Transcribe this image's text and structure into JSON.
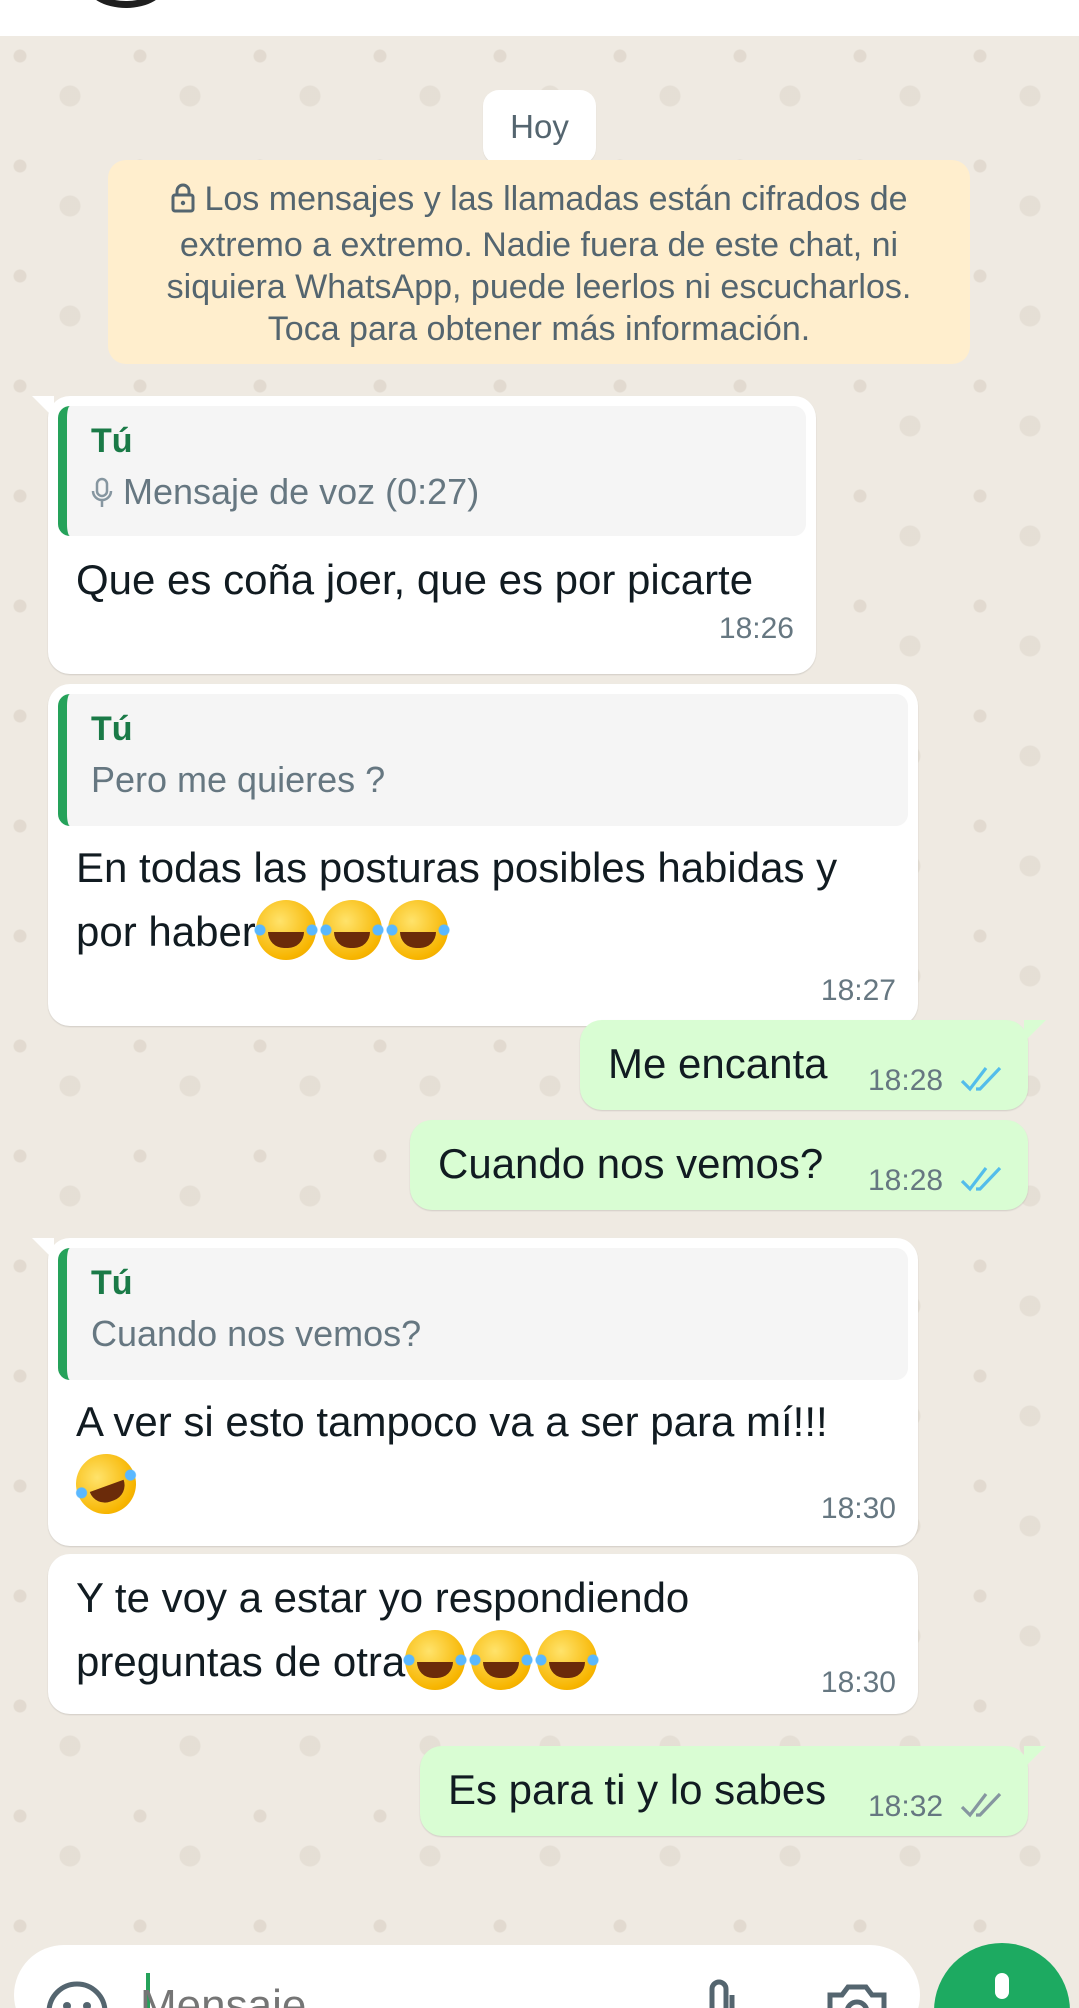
{
  "chat": {
    "day_chip": "Hoy",
    "encryption_notice": "Los mensajes y las llamadas están cifrados de extremo a extremo. Nadie fuera de este chat, ni siquiera WhatsApp, puede leerlos ni escucharlos. Toca para obtener más información.",
    "messages": [
      {
        "direction": "in",
        "quote_author": "Tú",
        "quote_text": "Mensaje de voz (0:27)",
        "quote_icon": "mic-icon",
        "text": "Que es coña joer, que es por picarte",
        "time": "18:26"
      },
      {
        "direction": "in",
        "quote_author": "Tú",
        "quote_text": "Pero me quieres ?",
        "text_line1": "En todas las posturas posibles habidas y",
        "text_line2": "por haber",
        "emoji": "😂😂😂",
        "time": "18:27"
      },
      {
        "direction": "out",
        "text": "Me encanta",
        "time": "18:28",
        "status": "read"
      },
      {
        "direction": "out",
        "text": "Cuando nos vemos?",
        "time": "18:28",
        "status": "read"
      },
      {
        "direction": "in",
        "quote_author": "Tú",
        "quote_text": "Cuando nos vemos?",
        "text": "A ver si esto tampoco va a ser para mí!!!",
        "emoji": "🤣",
        "time": "18:30"
      },
      {
        "direction": "in",
        "text_line1": "Y te voy a estar yo respondiendo",
        "text_line2": "preguntas de otra",
        "emoji": "😂😂😂",
        "time": "18:30"
      },
      {
        "direction": "out",
        "text": "Es para ti y lo sabes",
        "time": "18:32",
        "status": "delivered"
      }
    ]
  },
  "composer": {
    "placeholder": "Mensaje",
    "icons": [
      "emoji-icon",
      "attach-icon",
      "camera-icon",
      "mic-icon"
    ]
  },
  "colors": {
    "background": "#efeae2",
    "incoming_bubble": "#ffffff",
    "outgoing_bubble": "#d9fdd3",
    "read_tick": "#53bdeb",
    "delivered_tick": "#8696a0",
    "accent": "#1daa61"
  }
}
